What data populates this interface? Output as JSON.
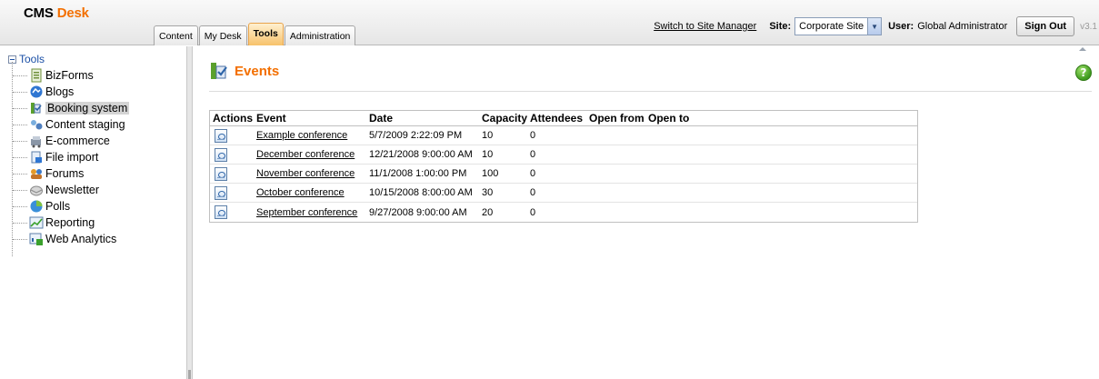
{
  "header": {
    "logo": {
      "part1": "CMS",
      "part2": "Desk"
    },
    "tabs": [
      {
        "label": "Content",
        "active": false
      },
      {
        "label": "My Desk",
        "active": false
      },
      {
        "label": "Tools",
        "active": true
      },
      {
        "label": "Administration",
        "active": false
      }
    ],
    "switch_link": "Switch to Site Manager",
    "site_label": "Site:",
    "site_value": "Corporate Site",
    "user_label": "User:",
    "user_value": "Global Administrator",
    "sign_out": "Sign Out",
    "version": "v3.1"
  },
  "sidebar": {
    "root_label": "Tools",
    "items": [
      {
        "label": "BizForms",
        "icon": "bizforms-icon"
      },
      {
        "label": "Blogs",
        "icon": "blogs-icon"
      },
      {
        "label": "Booking system",
        "icon": "booking-system-icon",
        "selected": true
      },
      {
        "label": "Content staging",
        "icon": "content-staging-icon"
      },
      {
        "label": "E-commerce",
        "icon": "ecommerce-icon"
      },
      {
        "label": "File import",
        "icon": "file-import-icon"
      },
      {
        "label": "Forums",
        "icon": "forums-icon"
      },
      {
        "label": "Newsletter",
        "icon": "newsletter-icon"
      },
      {
        "label": "Polls",
        "icon": "polls-icon"
      },
      {
        "label": "Reporting",
        "icon": "reporting-icon"
      },
      {
        "label": "Web Analytics",
        "icon": "web-analytics-icon"
      }
    ]
  },
  "main": {
    "title": "Events",
    "help": "?",
    "columns": {
      "actions": "Actions",
      "event": "Event",
      "date": "Date",
      "capacity": "Capacity",
      "attendees": "Attendees",
      "open_from": "Open from",
      "open_to": "Open to"
    },
    "rows": [
      {
        "event": "Example conference",
        "date": "5/7/2009 2:22:09 PM",
        "capacity": "10",
        "attendees": "0",
        "open_from": "",
        "open_to": ""
      },
      {
        "event": "December conference",
        "date": "12/21/2008 9:00:00 AM",
        "capacity": "10",
        "attendees": "0",
        "open_from": "",
        "open_to": ""
      },
      {
        "event": "November conference",
        "date": "11/1/2008 1:00:00 PM",
        "capacity": "100",
        "attendees": "0",
        "open_from": "",
        "open_to": ""
      },
      {
        "event": "October conference",
        "date": "10/15/2008 8:00:00 AM",
        "capacity": "30",
        "attendees": "0",
        "open_from": "",
        "open_to": ""
      },
      {
        "event": "September conference",
        "date": "9/27/2008 9:00:00 AM",
        "capacity": "20",
        "attendees": "0",
        "open_from": "",
        "open_to": ""
      }
    ]
  }
}
